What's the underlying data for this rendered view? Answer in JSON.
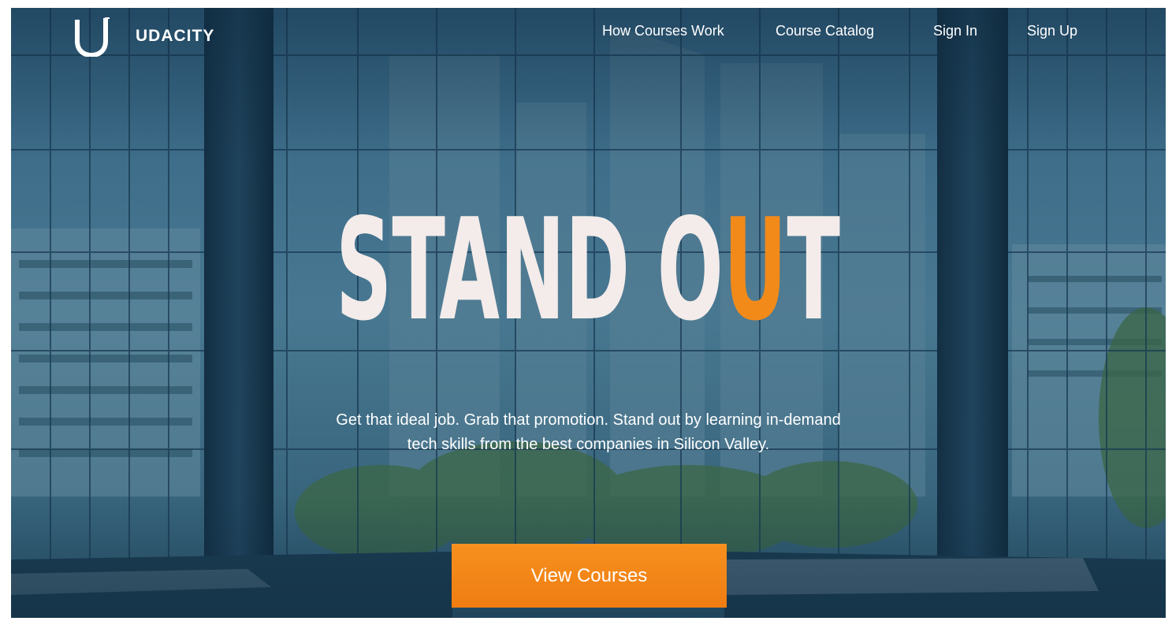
{
  "brand": {
    "name": "UDACITY",
    "logo_icon": "udacity-u-logo-icon"
  },
  "nav": {
    "links": [
      "How Courses Work",
      "Course Catalog",
      "Sign In",
      "Sign Up"
    ]
  },
  "hero": {
    "headline_white": "STAND O",
    "headline_accent": "U",
    "headline_end": "T",
    "tagline": "Get that ideal job. Grab that promotion. Stand out by learning in-demand tech skills from the best companies in Silicon Valley.",
    "cta_label": "View Courses"
  },
  "colors": {
    "accent": "#f28a1a",
    "overlay": "#1e4a6a",
    "text": "#ffffff"
  }
}
